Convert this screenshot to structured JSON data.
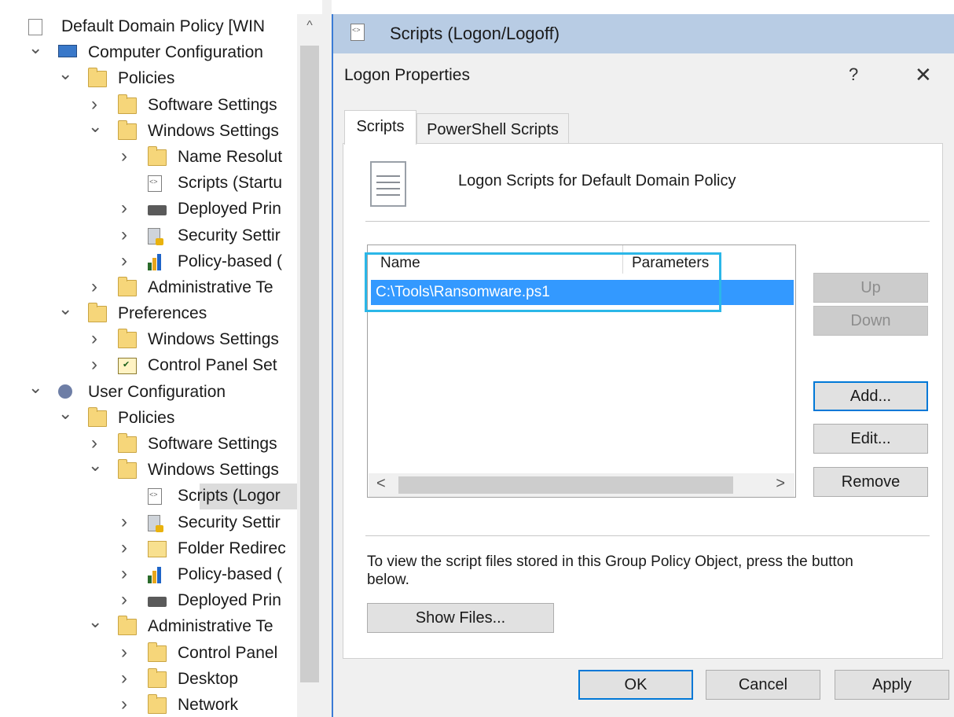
{
  "tree": {
    "items": [
      {
        "label": "Default Domain Policy [WIN",
        "indent": 0,
        "chev": "",
        "icon": "doc"
      },
      {
        "label": "Computer Configuration",
        "indent": 0,
        "chev": "down",
        "icon": "computer"
      },
      {
        "label": "Policies",
        "indent": 1,
        "chev": "down",
        "icon": "folder"
      },
      {
        "label": "Software Settings",
        "indent": 2,
        "chev": "right",
        "icon": "folder"
      },
      {
        "label": "Windows Settings",
        "indent": 2,
        "chev": "down",
        "icon": "folder"
      },
      {
        "label": "Name Resolut",
        "indent": 3,
        "chev": "right",
        "icon": "folder"
      },
      {
        "label": "Scripts (Startu",
        "indent": 3,
        "chev": "",
        "icon": "script"
      },
      {
        "label": "Deployed Prin",
        "indent": 3,
        "chev": "right",
        "icon": "printer"
      },
      {
        "label": "Security Settir",
        "indent": 3,
        "chev": "right",
        "icon": "security"
      },
      {
        "label": "Policy-based (",
        "indent": 3,
        "chev": "right",
        "icon": "bars"
      },
      {
        "label": "Administrative Te",
        "indent": 2,
        "chev": "right",
        "icon": "folder"
      },
      {
        "label": "Preferences",
        "indent": 1,
        "chev": "down",
        "icon": "folder"
      },
      {
        "label": "Windows Settings",
        "indent": 2,
        "chev": "right",
        "icon": "folder"
      },
      {
        "label": "Control Panel Set",
        "indent": 2,
        "chev": "right",
        "icon": "controlpanel"
      },
      {
        "label": "User Configuration",
        "indent": 0,
        "chev": "down",
        "icon": "user"
      },
      {
        "label": "Policies",
        "indent": 1,
        "chev": "down",
        "icon": "folder"
      },
      {
        "label": "Software Settings",
        "indent": 2,
        "chev": "right",
        "icon": "folder"
      },
      {
        "label": "Windows Settings",
        "indent": 2,
        "chev": "down",
        "icon": "folder"
      },
      {
        "label": "Scripts (Logor",
        "indent": 3,
        "chev": "",
        "icon": "script",
        "selected": true
      },
      {
        "label": "Security Settir",
        "indent": 3,
        "chev": "right",
        "icon": "security"
      },
      {
        "label": "Folder Redirec",
        "indent": 3,
        "chev": "right",
        "icon": "openfolder"
      },
      {
        "label": "Policy-based (",
        "indent": 3,
        "chev": "right",
        "icon": "bars"
      },
      {
        "label": "Deployed Prin",
        "indent": 3,
        "chev": "right",
        "icon": "printer"
      },
      {
        "label": "Administrative Te",
        "indent": 2,
        "chev": "down",
        "icon": "folder"
      },
      {
        "label": "Control Panel",
        "indent": 3,
        "chev": "right",
        "icon": "folder"
      },
      {
        "label": "Desktop",
        "indent": 3,
        "chev": "right",
        "icon": "folder"
      },
      {
        "label": "Network",
        "indent": 3,
        "chev": "right",
        "icon": "folder"
      }
    ]
  },
  "panel": {
    "title": "Scripts (Logon/Logoff)"
  },
  "dialog": {
    "title": "Logon Properties",
    "help": "?",
    "close": "✕",
    "tabs": {
      "scripts": "Scripts",
      "powershell": "PowerShell Scripts"
    },
    "heading": "Logon Scripts for Default Domain Policy",
    "list": {
      "col_name": "Name",
      "col_params": "Parameters",
      "rows": [
        {
          "name": "C:\\Tools\\Ransomware.ps1",
          "params": ""
        }
      ]
    },
    "buttons": {
      "up": "Up",
      "down": "Down",
      "add": "Add...",
      "edit": "Edit...",
      "remove": "Remove",
      "show_files": "Show Files...",
      "ok": "OK",
      "cancel": "Cancel",
      "apply": "Apply"
    },
    "note": "To view the script files stored in this Group Policy Object, press the button below."
  },
  "colors": {
    "selection": "#3399ff",
    "highlight_box": "#2bb7e8",
    "default_button": "#0078d7",
    "panel_title": "#b8cce4"
  }
}
